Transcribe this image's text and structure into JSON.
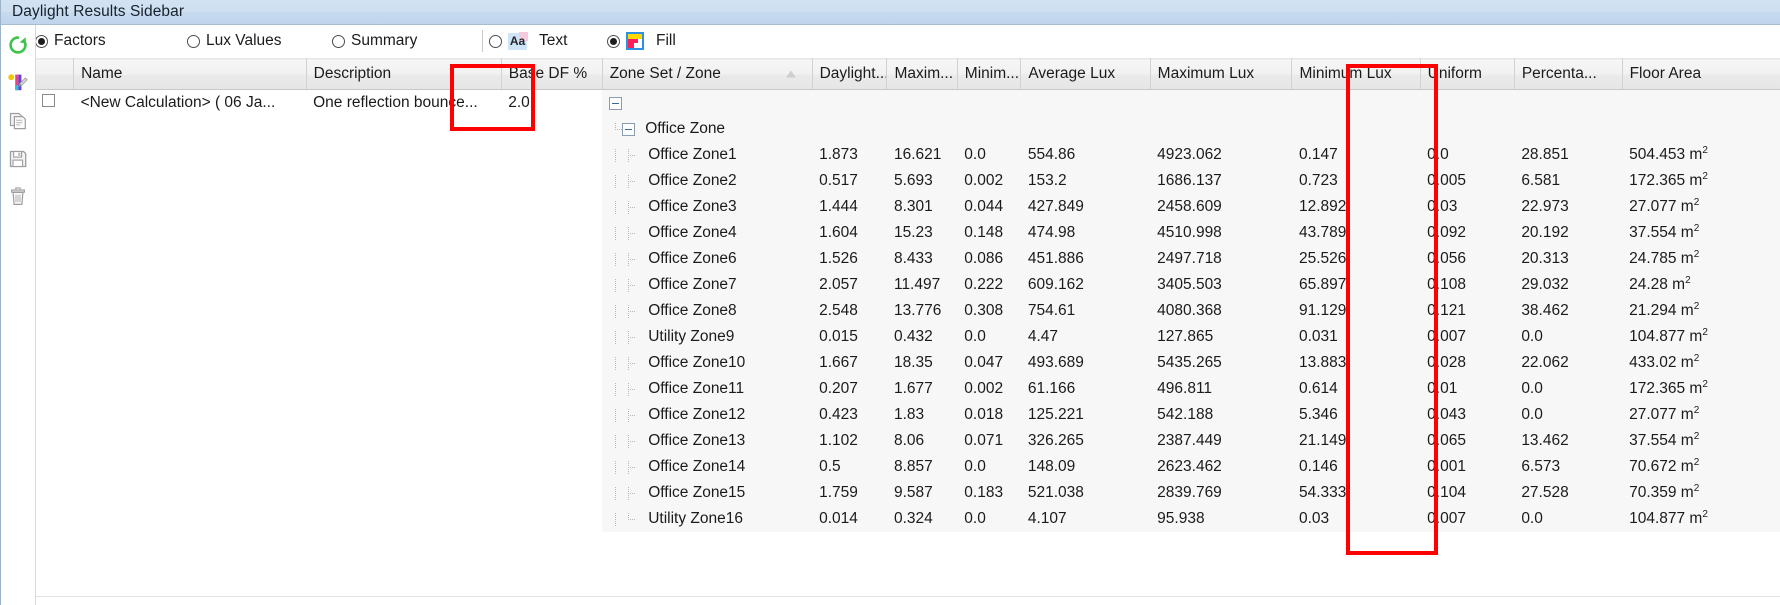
{
  "window": {
    "title": "Daylight Results Sidebar"
  },
  "rail": {
    "items": [
      {
        "name": "refresh-icon",
        "label": "Refresh",
        "color": "#3ec44a"
      },
      {
        "name": "color-pen-icon",
        "label": "Legend Colours",
        "color": "#e8467c"
      },
      {
        "name": "copy-icon",
        "label": "Copy",
        "color": "#b9b9b9"
      },
      {
        "name": "save-icon",
        "label": "Save",
        "color": "#b9b9b9"
      },
      {
        "name": "delete-icon",
        "label": "Delete",
        "color": "#b9b9b9"
      }
    ]
  },
  "toolbar": {
    "mode_group": [
      {
        "label": "Factors",
        "selected": true
      },
      {
        "label": "Lux Values",
        "selected": false
      },
      {
        "label": "Summary",
        "selected": false
      }
    ],
    "display_group": [
      {
        "label": "Text",
        "selected": false,
        "icon": "text-aa-icon",
        "icon_text": "Aa"
      },
      {
        "label": "Fill",
        "selected": true,
        "icon": "fill-swatch-icon"
      }
    ]
  },
  "grid": {
    "columns": [
      {
        "key": "check",
        "label": ""
      },
      {
        "key": "name",
        "label": "Name"
      },
      {
        "key": "description",
        "label": "Description"
      },
      {
        "key": "base_df",
        "label": "Base DF %",
        "highlighted": true
      },
      {
        "key": "zone",
        "label": "Zone Set / Zone",
        "sorted": true
      },
      {
        "key": "daylight",
        "label": "Daylight..."
      },
      {
        "key": "maximum",
        "label": "Maxim..."
      },
      {
        "key": "minimum",
        "label": "Minim..."
      },
      {
        "key": "average_lux",
        "label": "Average Lux"
      },
      {
        "key": "maximum_lux",
        "label": "Maximum Lux"
      },
      {
        "key": "minimum_lux",
        "label": "Minimum Lux"
      },
      {
        "key": "uniform",
        "label": "Uniform"
      },
      {
        "key": "percentage",
        "label": "Percenta...",
        "highlighted": true
      },
      {
        "key": "floor_area",
        "label": "Floor Area"
      }
    ],
    "calculation_row": {
      "checked": false,
      "name": "<New Calculation> ( 06 Ja...",
      "description": "One reflection bounce...",
      "base_df": "2.0"
    },
    "tree": {
      "root_label": "",
      "group_label": "Office Zone"
    },
    "rows": [
      {
        "zone": "Office Zone1",
        "daylight": "1.873",
        "maximum": "16.621",
        "minimum": "0.0",
        "average_lux": "554.86",
        "maximum_lux": "4923.062",
        "minimum_lux": "0.147",
        "uniform": "0.0",
        "percentage": "28.851",
        "floor_area": "504.453 m",
        "area_sup": "2"
      },
      {
        "zone": "Office Zone2",
        "daylight": "0.517",
        "maximum": "5.693",
        "minimum": "0.002",
        "average_lux": "153.2",
        "maximum_lux": "1686.137",
        "minimum_lux": "0.723",
        "uniform": "0.005",
        "percentage": "6.581",
        "floor_area": "172.365 m",
        "area_sup": "2"
      },
      {
        "zone": "Office Zone3",
        "daylight": "1.444",
        "maximum": "8.301",
        "minimum": "0.044",
        "average_lux": "427.849",
        "maximum_lux": "2458.609",
        "minimum_lux": "12.892",
        "uniform": "0.03",
        "percentage": "22.973",
        "floor_area": "27.077 m",
        "area_sup": "2"
      },
      {
        "zone": "Office Zone4",
        "daylight": "1.604",
        "maximum": "15.23",
        "minimum": "0.148",
        "average_lux": "474.98",
        "maximum_lux": "4510.998",
        "minimum_lux": "43.789",
        "uniform": "0.092",
        "percentage": "20.192",
        "floor_area": "37.554 m",
        "area_sup": "2"
      },
      {
        "zone": "Office Zone6",
        "daylight": "1.526",
        "maximum": "8.433",
        "minimum": "0.086",
        "average_lux": "451.886",
        "maximum_lux": "2497.718",
        "minimum_lux": "25.526",
        "uniform": "0.056",
        "percentage": "20.313",
        "floor_area": "24.785 m",
        "area_sup": "2"
      },
      {
        "zone": "Office Zone7",
        "daylight": "2.057",
        "maximum": "11.497",
        "minimum": "0.222",
        "average_lux": "609.162",
        "maximum_lux": "3405.503",
        "minimum_lux": "65.897",
        "uniform": "0.108",
        "percentage": "29.032",
        "floor_area": "24.28 m",
        "area_sup": "2"
      },
      {
        "zone": "Office Zone8",
        "daylight": "2.548",
        "maximum": "13.776",
        "minimum": "0.308",
        "average_lux": "754.61",
        "maximum_lux": "4080.368",
        "minimum_lux": "91.129",
        "uniform": "0.121",
        "percentage": "38.462",
        "floor_area": "21.294 m",
        "area_sup": "2"
      },
      {
        "zone": "Utility Zone9",
        "daylight": "0.015",
        "maximum": "0.432",
        "minimum": "0.0",
        "average_lux": "4.47",
        "maximum_lux": "127.865",
        "minimum_lux": "0.031",
        "uniform": "0.007",
        "percentage": "0.0",
        "floor_area": "104.877 m",
        "area_sup": "2"
      },
      {
        "zone": "Office Zone10",
        "daylight": "1.667",
        "maximum": "18.35",
        "minimum": "0.047",
        "average_lux": "493.689",
        "maximum_lux": "5435.265",
        "minimum_lux": "13.883",
        "uniform": "0.028",
        "percentage": "22.062",
        "floor_area": "433.02 m",
        "area_sup": "2"
      },
      {
        "zone": "Office Zone11",
        "daylight": "0.207",
        "maximum": "1.677",
        "minimum": "0.002",
        "average_lux": "61.166",
        "maximum_lux": "496.811",
        "minimum_lux": "0.614",
        "uniform": "0.01",
        "percentage": "0.0",
        "floor_area": "172.365 m",
        "area_sup": "2"
      },
      {
        "zone": "Office Zone12",
        "daylight": "0.423",
        "maximum": "1.83",
        "minimum": "0.018",
        "average_lux": "125.221",
        "maximum_lux": "542.188",
        "minimum_lux": "5.346",
        "uniform": "0.043",
        "percentage": "0.0",
        "floor_area": "27.077 m",
        "area_sup": "2"
      },
      {
        "zone": "Office Zone13",
        "daylight": "1.102",
        "maximum": "8.06",
        "minimum": "0.071",
        "average_lux": "326.265",
        "maximum_lux": "2387.449",
        "minimum_lux": "21.149",
        "uniform": "0.065",
        "percentage": "13.462",
        "floor_area": "37.554 m",
        "area_sup": "2"
      },
      {
        "zone": "Office Zone14",
        "daylight": "0.5",
        "maximum": "8.857",
        "minimum": "0.0",
        "average_lux": "148.09",
        "maximum_lux": "2623.462",
        "minimum_lux": "0.146",
        "uniform": "0.001",
        "percentage": "6.573",
        "floor_area": "70.672 m",
        "area_sup": "2"
      },
      {
        "zone": "Office Zone15",
        "daylight": "1.759",
        "maximum": "9.587",
        "minimum": "0.183",
        "average_lux": "521.038",
        "maximum_lux": "2839.769",
        "minimum_lux": "54.333",
        "uniform": "0.104",
        "percentage": "27.528",
        "floor_area": "70.359 m",
        "area_sup": "2"
      },
      {
        "zone": "Utility Zone16",
        "daylight": "0.014",
        "maximum": "0.324",
        "minimum": "0.0",
        "average_lux": "4.107",
        "maximum_lux": "95.938",
        "minimum_lux": "0.03",
        "uniform": "0.007",
        "percentage": "0.0",
        "floor_area": "104.877 m",
        "area_sup": "2"
      }
    ]
  },
  "annotations": {
    "highlight_color": "#ff0000",
    "boxes": [
      {
        "name": "base-df-highlight",
        "target": "Base DF %"
      },
      {
        "name": "percentage-highlight",
        "target": "Percenta..."
      }
    ]
  }
}
